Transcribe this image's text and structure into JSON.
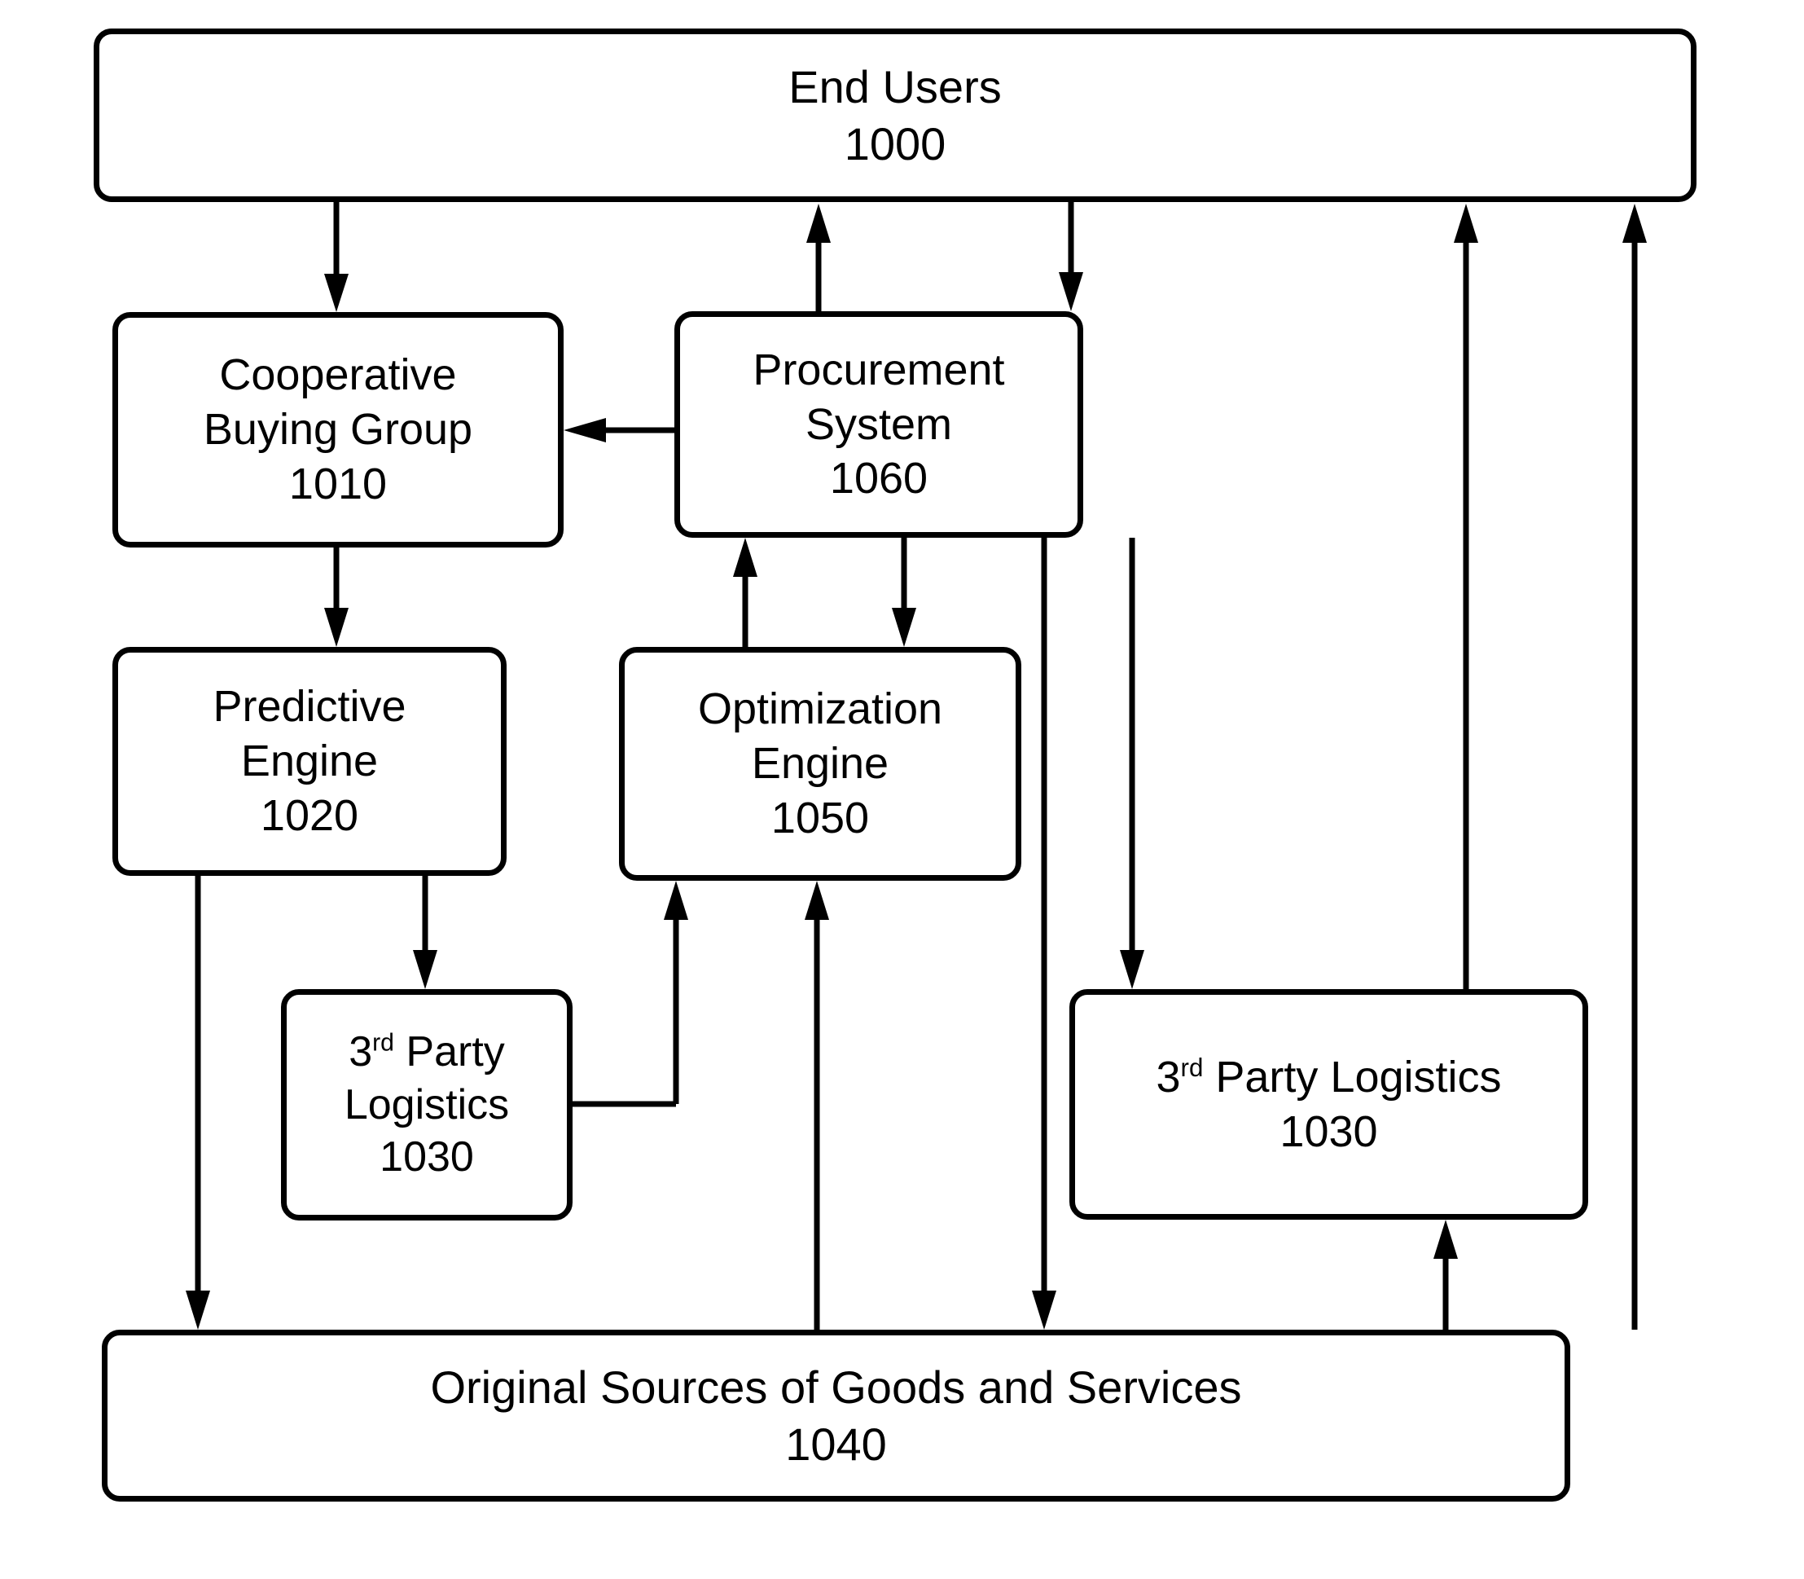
{
  "diagram": {
    "type": "block-flow-diagram",
    "background": "#ffffff",
    "stroke_color": "#000000",
    "nodes": [
      {
        "id": "end_users",
        "label": "End Users",
        "ref": "1000"
      },
      {
        "id": "cooperative_buying_group",
        "label_line1": "Cooperative",
        "label_line2": "Buying Group",
        "ref": "1010"
      },
      {
        "id": "procurement_system",
        "label_line1": "Procurement",
        "label_line2": "System",
        "ref": "1060"
      },
      {
        "id": "predictive_engine",
        "label_line1": "Predictive",
        "label_line2": "Engine",
        "ref": "1020"
      },
      {
        "id": "optimization_engine",
        "label_line1": "Optimization",
        "label_line2": "Engine",
        "ref": "1050"
      },
      {
        "id": "third_party_logistics_left",
        "label_prefix": "3",
        "label_superscript": "rd",
        "label_line1_rest": " Party",
        "label_line2": "Logistics",
        "ref": "1030"
      },
      {
        "id": "third_party_logistics_right",
        "label_prefix": "3",
        "label_superscript": "rd",
        "label_line1_rest": " Party Logistics",
        "ref": "1030"
      },
      {
        "id": "original_sources",
        "label": "Original Sources of Goods and Services",
        "ref": "1040"
      }
    ],
    "connections": [
      {
        "from": "end_users",
        "to": "cooperative_buying_group",
        "direction": "down"
      },
      {
        "from": "procurement_system",
        "to": "end_users",
        "direction": "up"
      },
      {
        "from": "end_users",
        "to": "procurement_system",
        "direction": "down"
      },
      {
        "from": "procurement_system",
        "to": "cooperative_buying_group",
        "direction": "left"
      },
      {
        "from": "cooperative_buying_group",
        "to": "predictive_engine",
        "direction": "down"
      },
      {
        "from": "optimization_engine",
        "to": "procurement_system",
        "direction": "up"
      },
      {
        "from": "procurement_system",
        "to": "optimization_engine",
        "direction": "down"
      },
      {
        "from": "procurement_system",
        "to": "third_party_logistics_right",
        "direction": "down"
      },
      {
        "from": "procurement_system",
        "to": "original_sources",
        "direction": "down"
      },
      {
        "from": "predictive_engine",
        "to": "original_sources",
        "direction": "down"
      },
      {
        "from": "predictive_engine",
        "to": "third_party_logistics_left",
        "direction": "down"
      },
      {
        "from": "third_party_logistics_left",
        "to": "optimization_engine",
        "direction": "up"
      },
      {
        "from": "original_sources",
        "to": "optimization_engine",
        "direction": "up"
      },
      {
        "from": "original_sources",
        "to": "third_party_logistics_right",
        "direction": "up"
      },
      {
        "from": "third_party_logistics_right",
        "to": "end_users",
        "direction": "up"
      },
      {
        "from": "original_sources",
        "to": "end_users",
        "direction": "up"
      }
    ]
  }
}
